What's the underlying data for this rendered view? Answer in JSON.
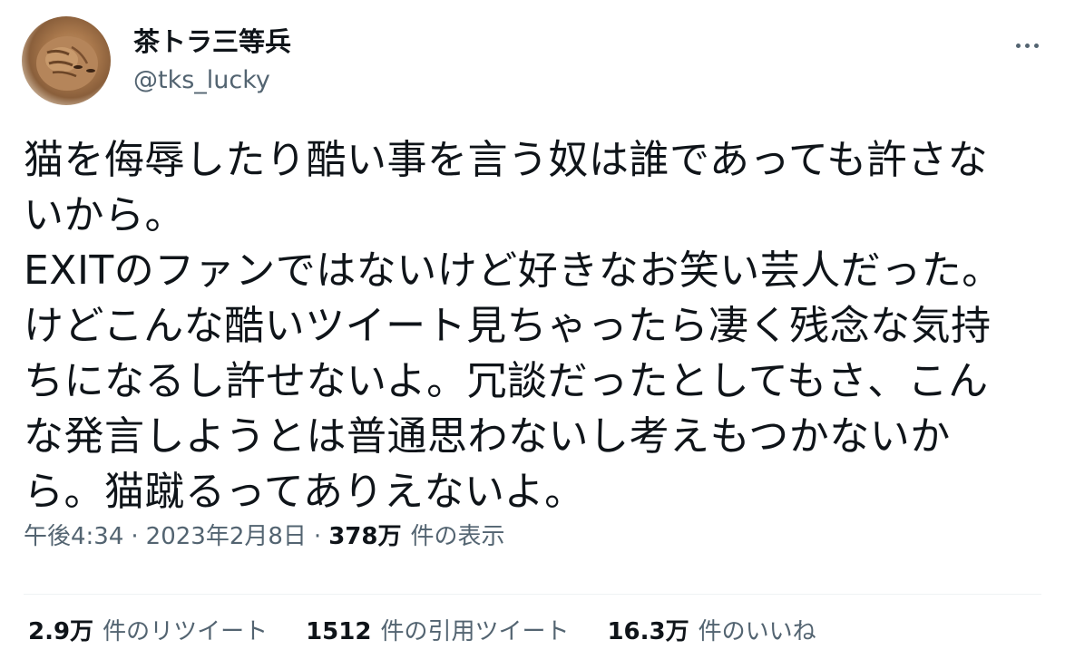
{
  "user": {
    "display_name": "茶トラ三等兵",
    "handle": "@tks_lucky",
    "avatar_icon": "cat-avatar-icon"
  },
  "tweet": {
    "lines": [
      "猫を侮辱したり酷い事を言う奴は誰であっても許さな",
      "いから。",
      "EXITのファンではないけど好きなお笑い芸人だった。",
      "けどこんな酷いツイート見ちゃったら凄く残念な気持",
      "ちになるし許せないよ。冗談だったとしてもさ、こん",
      "な発言しようとは普通思わないし考えもつかないか",
      "ら。猫蹴るってありえないよ。"
    ]
  },
  "meta": {
    "time": "午後4:34",
    "separator": "·",
    "date": "2023年2月8日",
    "views_count": "378万",
    "views_label": "件の表示"
  },
  "stats": {
    "retweets": {
      "count": "2.9万",
      "label": "件のリツイート"
    },
    "quotes": {
      "count": "1512",
      "label": "件の引用ツイート"
    },
    "likes": {
      "count": "16.3万",
      "label": "件のいいね"
    }
  },
  "colors": {
    "text": "#0f1419",
    "secondary": "#536471",
    "divider": "#eff3f4"
  },
  "icons": {
    "more": "more-options-icon"
  }
}
